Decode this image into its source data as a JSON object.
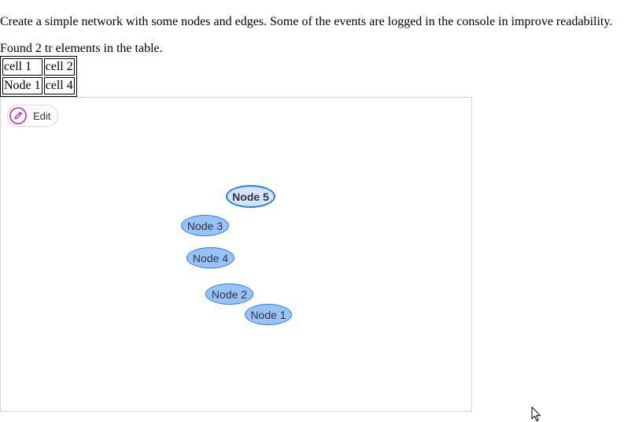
{
  "intro_text": "Create a simple network with some nodes and edges. Some of the events are logged in the console in improve readability.",
  "found_text": "Found 2 tr elements in the table.",
  "table": {
    "rows": [
      [
        "cell 1",
        "cell 2"
      ],
      [
        "Node 1",
        "cell 4"
      ]
    ]
  },
  "network": {
    "edit_label": "Edit",
    "edit_icon": "pencil-icon",
    "nodes": [
      {
        "label": "Node 5",
        "selected": true
      },
      {
        "label": "Node 3",
        "selected": false
      },
      {
        "label": "Node 4",
        "selected": false
      },
      {
        "label": "Node 2",
        "selected": false
      },
      {
        "label": "Node 1",
        "selected": false
      }
    ],
    "colors": {
      "node_fill": "#97c2fc",
      "node_border": "#2b7ce9",
      "selected_fill": "#d2e5ff",
      "edit_icon": "#c52ab8"
    }
  }
}
